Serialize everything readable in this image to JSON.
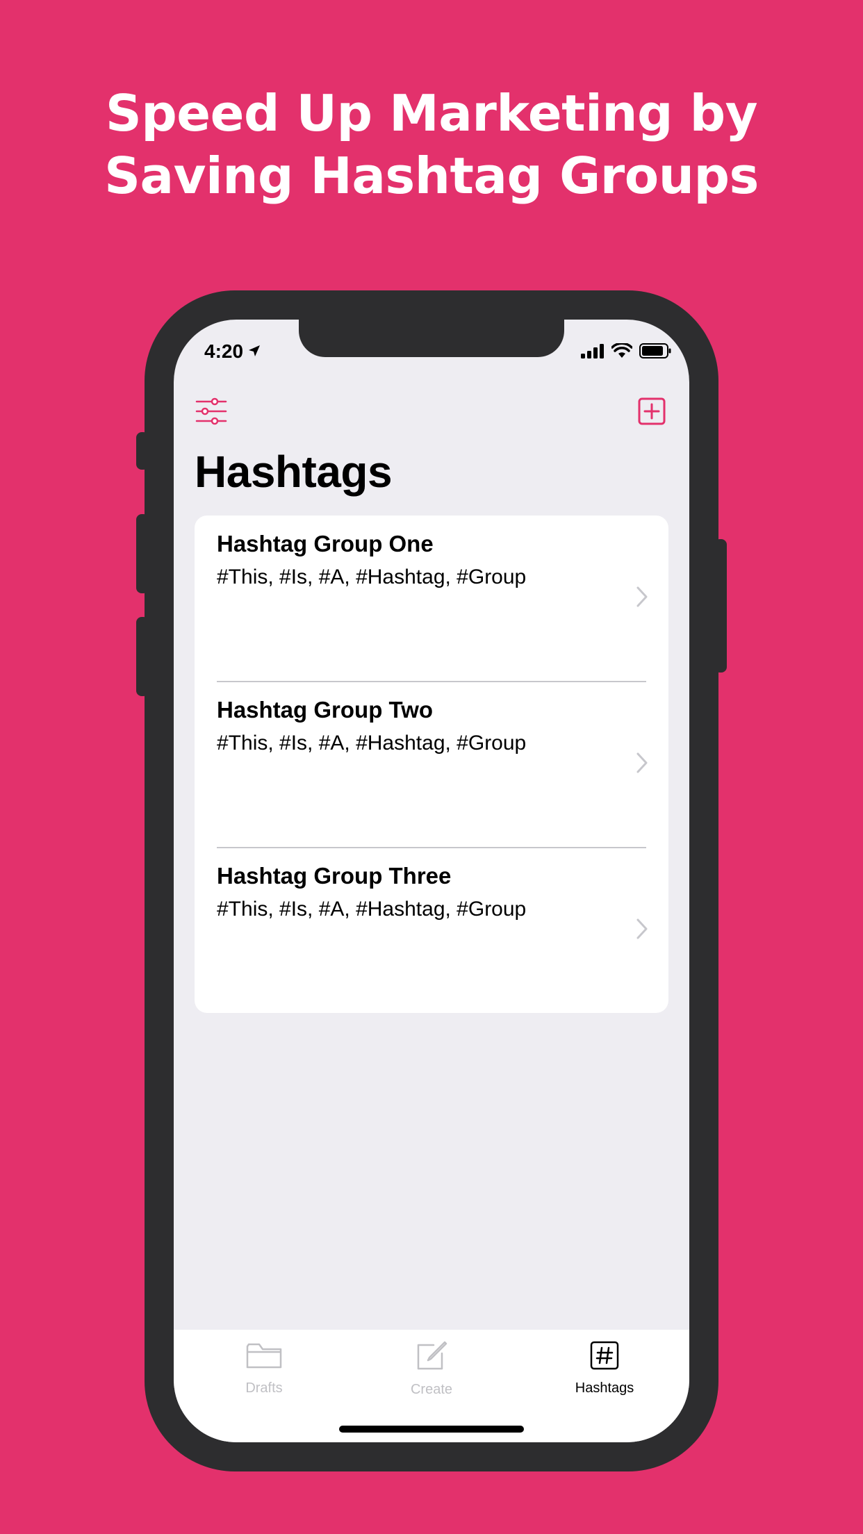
{
  "headline": {
    "line1": "Speed Up Marketing by",
    "line2": "Saving Hashtag Groups"
  },
  "colors": {
    "background": "#E3316C",
    "accent": "#E3316C",
    "phone_frame": "#2D2D2F",
    "screen_bg": "#EEEDF2"
  },
  "status_bar": {
    "time": "4:20",
    "icons": [
      "location-arrow-icon",
      "signal-icon",
      "wifi-icon",
      "battery-icon"
    ]
  },
  "nav": {
    "left_icon": "sliders-icon",
    "right_icon": "plus-square-icon",
    "title": "Hashtags"
  },
  "groups": [
    {
      "title": "Hashtag Group One",
      "tags": "#This, #Is, #A, #Hashtag, #Group"
    },
    {
      "title": "Hashtag Group Two",
      "tags": "#This, #Is, #A, #Hashtag, #Group"
    },
    {
      "title": "Hashtag Group Three",
      "tags": "#This, #Is, #A, #Hashtag, #Group"
    }
  ],
  "tabbar": {
    "tabs": [
      {
        "label": "Drafts",
        "icon": "folder-icon",
        "active": false
      },
      {
        "label": "Create",
        "icon": "compose-icon",
        "active": false
      },
      {
        "label": "Hashtags",
        "icon": "hashtag-icon",
        "active": true
      }
    ]
  }
}
